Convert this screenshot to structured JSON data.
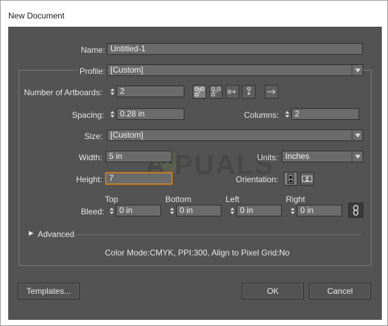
{
  "window": {
    "title": "New Document"
  },
  "name": {
    "label": "Name:",
    "value": "Untitled-1"
  },
  "profile": {
    "label": "Profile:",
    "value": "[Custom]"
  },
  "artboards": {
    "label": "Number of Artboards:",
    "value": "2",
    "layout_icons": [
      "grid-by-row-icon",
      "grid-by-column-icon",
      "arrange-by-row-icon",
      "arrange-by-column-icon"
    ],
    "direction_icon": "right-to-left-arrow-icon"
  },
  "spacing": {
    "label": "Spacing:",
    "value": "0.28 in"
  },
  "columns": {
    "label": "Columns:",
    "value": "2"
  },
  "size": {
    "label": "Size:",
    "value": "[Custom]"
  },
  "width": {
    "label": "Width:",
    "value": "5 in"
  },
  "units": {
    "label": "Units:",
    "value": "Inches"
  },
  "height": {
    "label": "Height:",
    "value": "7"
  },
  "orientation": {
    "label": "Orientation:",
    "icons": [
      "portrait-icon",
      "landscape-icon"
    ]
  },
  "bleed": {
    "label": "Bleed:",
    "top": {
      "label": "Top",
      "value": "0 in"
    },
    "bottom": {
      "label": "Bottom",
      "value": "0 in"
    },
    "left": {
      "label": "Left",
      "value": "0 in"
    },
    "right": {
      "label": "Right",
      "value": "0 in"
    },
    "link_icon": "chain-link-icon"
  },
  "advanced": {
    "label": "Advanced"
  },
  "summary": "Color Mode:CMYK, PPI:300, Align to Pixel Grid:No",
  "buttons": {
    "templates": "Templates...",
    "ok": "OK",
    "cancel": "Cancel"
  },
  "watermark": {
    "text": "A  PUALS"
  },
  "colors": {
    "dialog_bg": "#535353",
    "field_bg": "#6b6b6b",
    "focus": "#d98a2a"
  }
}
